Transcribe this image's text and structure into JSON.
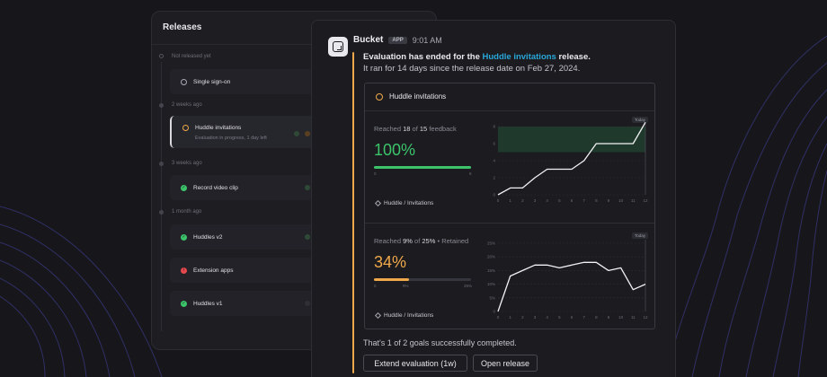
{
  "releases": {
    "title": "Releases",
    "groups": [
      {
        "label": "Not released yet",
        "items": [
          {
            "name": "Single sign-on",
            "status": "pending"
          }
        ]
      },
      {
        "label": "2 weeks ago",
        "items": [
          {
            "name": "Huddle invitations",
            "status": "in-progress",
            "subtitle": "Evaluation in progress, 1 day left"
          }
        ]
      },
      {
        "label": "3 weeks ago",
        "items": [
          {
            "name": "Record video clip",
            "status": "success"
          }
        ]
      },
      {
        "label": "1 month ago",
        "items": [
          {
            "name": "Huddles v2",
            "status": "success"
          },
          {
            "name": "Extension apps",
            "status": "failed"
          },
          {
            "name": "Huddles v1",
            "status": "success"
          }
        ]
      }
    ]
  },
  "message": {
    "sender": "Bucket",
    "badge": "APP",
    "time": "9:01 AM",
    "line1_prefix": "Evaluation has ended for the ",
    "line1_link": "Huddle invitations",
    "line1_suffix": " release.",
    "line2": "It ran for 14 days since the release date on Feb 27, 2024.",
    "card_title": "Huddle invitations",
    "goal1": {
      "caption_prefix": "Reached ",
      "caption_value": "18",
      "caption_mid": " of ",
      "caption_target": "15",
      "caption_suffix": " feedback",
      "big": "100%",
      "progress": 1.0,
      "bar_min": "0",
      "bar_max": "8",
      "feature": "Huddle / Invitations",
      "today": "Today"
    },
    "goal2": {
      "caption_prefix": "Reached ",
      "caption_value": "9%",
      "caption_mid": " of ",
      "caption_target": "25%",
      "caption_suffix": " • Retained",
      "big": "34%",
      "progress": 0.36,
      "bar_min": "0",
      "bar_mark": "9%",
      "bar_max": "25%",
      "feature": "Huddle / Invitations",
      "today": "Today"
    },
    "goals_summary": "That's 1 of 2 goals successfully completed.",
    "btn_extend": "Extend evaluation (1w)",
    "btn_open": "Open release"
  },
  "colors": {
    "accent": "#f0a94a",
    "success": "#3cc46b",
    "link": "#2aa7d8",
    "danger": "#e5484d"
  },
  "chart_data": [
    {
      "type": "line",
      "x": [
        0,
        1,
        2,
        3,
        4,
        5,
        6,
        7,
        8,
        9,
        10,
        11,
        12
      ],
      "xticks": [
        "0",
        "1",
        "2",
        "3",
        "4",
        "5",
        "6",
        "7",
        "8",
        "9",
        "10",
        "11",
        "12"
      ],
      "yticks": [
        "0",
        "2",
        "4",
        "6",
        "8"
      ],
      "ylim": [
        0,
        8
      ],
      "values": [
        0,
        0.8,
        0.8,
        2,
        3,
        3,
        3,
        4,
        6,
        6,
        6,
        6,
        8.5
      ],
      "target_band": [
        5,
        8
      ]
    },
    {
      "type": "line",
      "x": [
        0,
        1,
        2,
        3,
        4,
        5,
        6,
        7,
        8,
        9,
        10,
        11,
        12
      ],
      "xticks": [
        "0",
        "1",
        "2",
        "3",
        "4",
        "5",
        "6",
        "7",
        "8",
        "9",
        "10",
        "11",
        "12"
      ],
      "yticks": [
        "0",
        "5%",
        "10%",
        "15%",
        "20%",
        "25%"
      ],
      "ylim": [
        0,
        25
      ],
      "values": [
        0,
        13,
        15,
        17,
        17,
        16,
        17,
        18,
        18,
        15,
        16,
        8,
        10
      ]
    }
  ]
}
